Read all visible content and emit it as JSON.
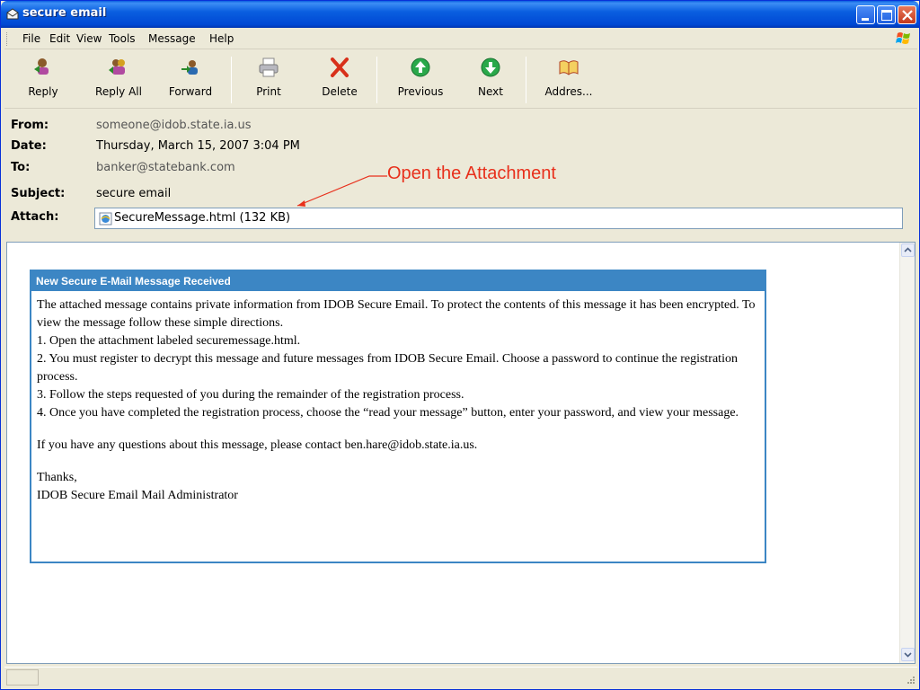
{
  "window": {
    "title": "secure email"
  },
  "menu": [
    "File",
    "Edit",
    "View",
    "Tools",
    "Message",
    "Help"
  ],
  "toolbar": {
    "reply": "Reply",
    "reply_all": "Reply All",
    "forward": "Forward",
    "print": "Print",
    "delete": "Delete",
    "previous": "Previous",
    "next": "Next",
    "addresses": "Addres..."
  },
  "headers": {
    "from_label": "From:",
    "from_value": "someone@idob.state.ia.us",
    "date_label": "Date:",
    "date_value": "Thursday, March 15, 2007 3:04 PM",
    "to_label": "To:",
    "to_value": "banker@statebank.com",
    "subject_label": "Subject:",
    "subject_value": "secure email",
    "attach_label": "Attach:",
    "attach_value": "SecureMessage.html (132 KB)"
  },
  "annotation": "Open the Attachment",
  "message": {
    "heading": "New Secure E-Mail Message Received",
    "intro": "The attached message contains private information from IDOB Secure Email. To protect the contents of this message it has been encrypted. To view the message follow these simple directions.",
    "step1": "1. Open the attachment labeled securemessage.html.",
    "step2": "2. You must register to decrypt this message and future messages from IDOB Secure Email. Choose a password to continue the registration process.",
    "step3": "3. Follow the steps requested of you during the remainder of the registration process.",
    "step4": "4. Once you have completed the registration process, choose the “read your message” button, enter your password, and view your message.",
    "questions": "If you have any questions about this message, please contact ben.hare@idob.state.ia.us.",
    "thanks": "Thanks,",
    "signature": "IDOB Secure Email Mail Administrator"
  },
  "colors": {
    "titlebar": "#0a5fe0",
    "card_header": "#3c86c4",
    "annotation": "#e8301c"
  }
}
